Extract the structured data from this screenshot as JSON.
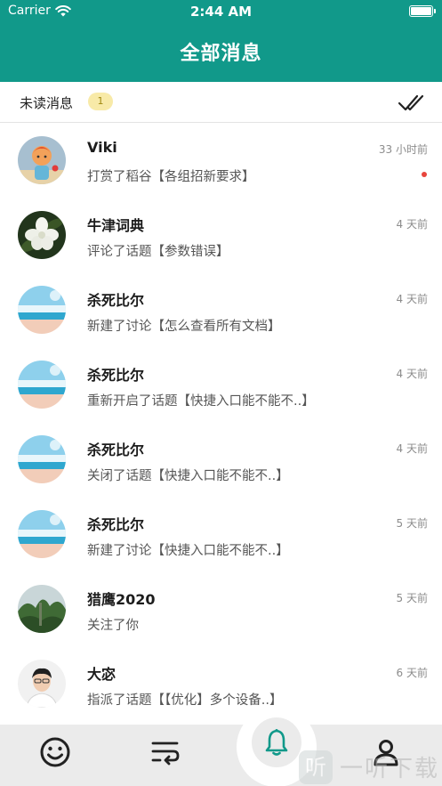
{
  "status_bar": {
    "carrier": "Carrier",
    "time": "2:44 AM"
  },
  "header": {
    "title": "全部消息"
  },
  "filter": {
    "label": "未读消息",
    "unread_badge": "1"
  },
  "messages": [
    {
      "name": "Viki",
      "time": "33 小时前",
      "summary": "打赏了稻谷【各组招新要求】",
      "unread": true,
      "avatar": "cartoon-avatar"
    },
    {
      "name": "牛津词典",
      "time": "4 天前",
      "summary": "评论了话题【参数错误】",
      "unread": false,
      "avatar": "flower-avatar"
    },
    {
      "name": "杀死比尔",
      "time": "4 天前",
      "summary": "新建了讨论【怎么查看所有文档】",
      "unread": false,
      "avatar": "beach-avatar"
    },
    {
      "name": "杀死比尔",
      "time": "4 天前",
      "summary": "重新开启了话题【快捷入口能不能不..】",
      "unread": false,
      "avatar": "beach-avatar"
    },
    {
      "name": "杀死比尔",
      "time": "4 天前",
      "summary": "关闭了话题【快捷入口能不能不..】",
      "unread": false,
      "avatar": "beach-avatar"
    },
    {
      "name": "杀死比尔",
      "time": "5 天前",
      "summary": "新建了讨论【快捷入口能不能不..】",
      "unread": false,
      "avatar": "beach-avatar"
    },
    {
      "name": "猎鹰2020",
      "time": "5 天前",
      "summary": "关注了你",
      "unread": false,
      "avatar": "forest-avatar"
    },
    {
      "name": "大宓",
      "time": "6 天前",
      "summary": "指派了话题【【优化】多个设备..】",
      "unread": false,
      "avatar": "portrait-avatar"
    }
  ],
  "tabbar": {
    "tabs": [
      "smiley-icon",
      "list-icon",
      "bell-icon",
      "user-icon"
    ],
    "active": "bell-icon"
  },
  "watermark": {
    "glyph": "听",
    "text": "一听下载"
  },
  "colors": {
    "primary": "#11998a",
    "unread_dot": "#e8453c",
    "badge_bg": "#f8eaa8"
  }
}
